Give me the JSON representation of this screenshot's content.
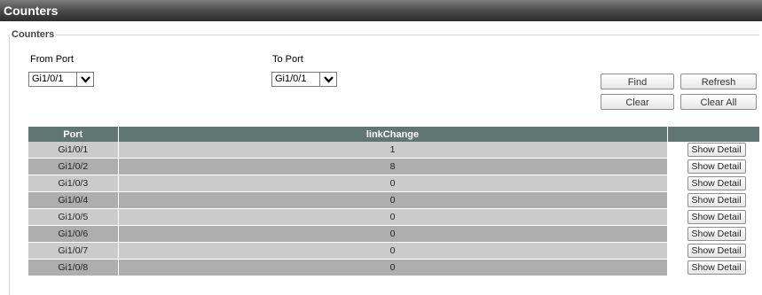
{
  "window": {
    "title": "Counters"
  },
  "panel": {
    "legend": "Counters"
  },
  "filters": {
    "from_port": {
      "label": "From Port",
      "value": "Gi1/0/1"
    },
    "to_port": {
      "label": "To Port",
      "value": "Gi1/0/1"
    }
  },
  "buttons": {
    "find": "Find",
    "refresh": "Refresh",
    "clear": "Clear",
    "clear_all": "Clear All"
  },
  "table": {
    "headers": [
      "Port",
      "linkChange",
      ""
    ],
    "action_label": "Show Detail",
    "rows": [
      {
        "port": "Gi1/0/1",
        "link_change": "1"
      },
      {
        "port": "Gi1/0/2",
        "link_change": "8"
      },
      {
        "port": "Gi1/0/3",
        "link_change": "0"
      },
      {
        "port": "Gi1/0/4",
        "link_change": "0"
      },
      {
        "port": "Gi1/0/5",
        "link_change": "0"
      },
      {
        "port": "Gi1/0/6",
        "link_change": "0"
      },
      {
        "port": "Gi1/0/7",
        "link_change": "0"
      },
      {
        "port": "Gi1/0/8",
        "link_change": "0"
      }
    ]
  }
}
